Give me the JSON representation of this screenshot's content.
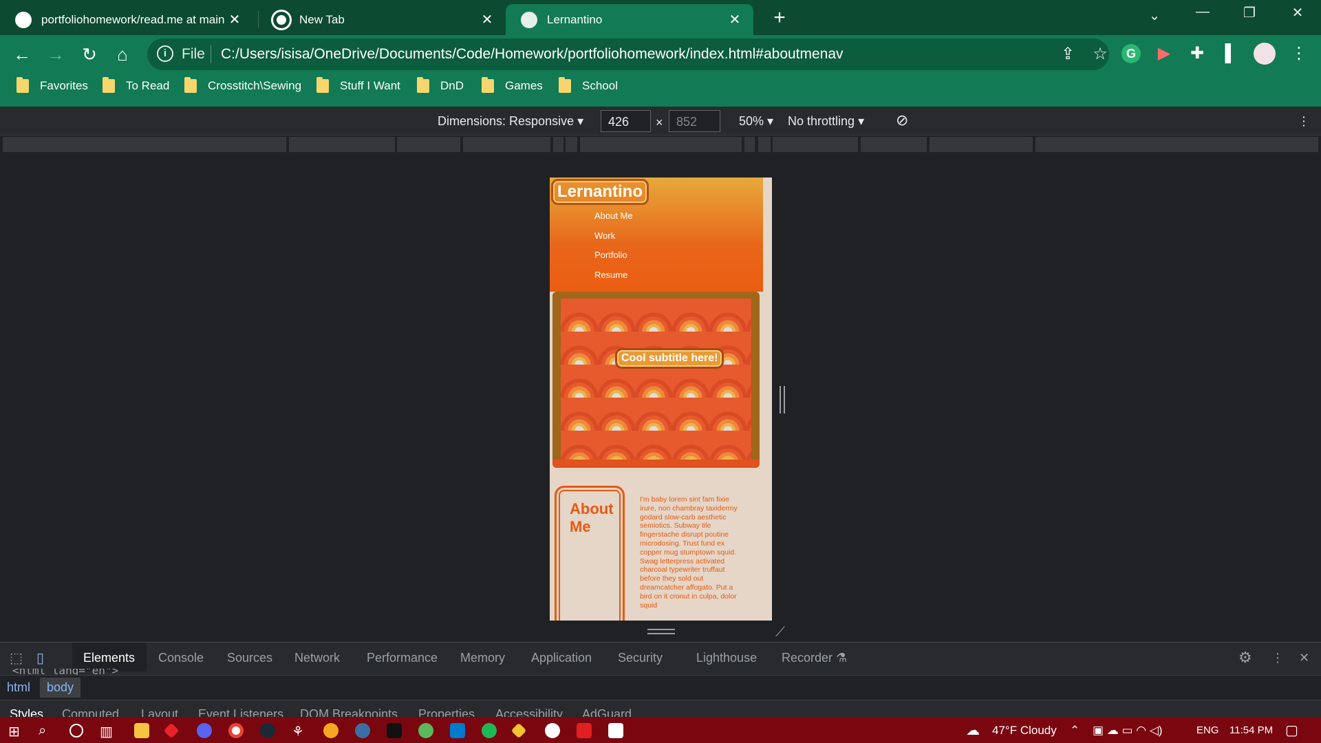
{
  "browser": {
    "tabs": [
      {
        "title": "portfoliohomework/read.me at main",
        "icon": "github-icon"
      },
      {
        "title": "New Tab",
        "icon": "chrome-icon"
      },
      {
        "title": "Lernantino",
        "icon": "globe-icon"
      }
    ],
    "new_tab": "+",
    "address": {
      "scheme_label": "File",
      "url": "C:/Users/isisa/OneDrive/Documents/Code/Homework/portfoliohomework/index.html#aboutmenav"
    },
    "bookmarks": [
      "Favorites",
      "To Read",
      "Crosstitch\\Sewing",
      "Stuff I Want",
      "DnD",
      "Games",
      "School"
    ]
  },
  "device_toolbar": {
    "dimensions_label": "Dimensions: Responsive",
    "width": "426",
    "height_placeholder": "852",
    "zoom": "50%",
    "throttling": "No throttling",
    "times": "×"
  },
  "site": {
    "brand": "Lernantino",
    "nav": [
      "About Me",
      "Work",
      "Portfolio",
      "Resume"
    ],
    "hero_subtitle": "Cool subtitle here!",
    "about_title": "About Me",
    "about_text": "I'm baby lorem sint fam fixie irure, non chambray taxidermy godard slow-carb aesthetic semiotics. Subway tile fingerstache disrupt poutine microdosing. Trust fund ex copper mug stumptown squid. Swag letterpress activated charcoal typewriter truffaut before they sold out dreamcatcher affogato. Put a bird on it cronut in culpa, dolor squid"
  },
  "devtools": {
    "tabs": [
      "Elements",
      "Console",
      "Sources",
      "Network",
      "Performance",
      "Memory",
      "Application",
      "Security",
      "Lighthouse",
      "Recorder"
    ],
    "active_tab": "Elements",
    "dom_snippet": "<html lang=\"en\">",
    "breadcrumbs": [
      "html",
      "body"
    ],
    "subtabs": [
      "Styles",
      "Computed",
      "Layout",
      "Event Listeners",
      "DOM Breakpoints",
      "Properties",
      "Accessibility",
      "AdGuard"
    ]
  },
  "taskbar": {
    "weather": "47°F  Cloudy",
    "language": "ENG",
    "time": "11:54 PM"
  },
  "colors": {
    "tab_strip": "#0c4a32",
    "toolbar": "#127a54",
    "header_orange": "#e9661a",
    "accent_orange": "#e65a14",
    "site_bg": "#e5d6c7",
    "taskbar": "#7a0710"
  }
}
